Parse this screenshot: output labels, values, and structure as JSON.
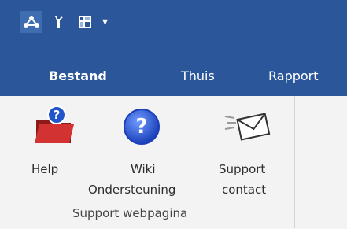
{
  "quick_access": {
    "icons": [
      "network-icon",
      "wrench-icon",
      "grid-icon",
      "dropdown-icon"
    ]
  },
  "tabs": [
    {
      "label": "Bestand"
    },
    {
      "label": "Thuis"
    },
    {
      "label": "Rapport"
    }
  ],
  "ribbon": {
    "buttons": [
      {
        "label": "Help",
        "icon": "help-folder-icon"
      },
      {
        "label_line1": "Wiki",
        "label_line2": "Ondersteuning",
        "icon": "question-circle-icon"
      },
      {
        "label_line1": "Support",
        "label_line2": "contact",
        "icon": "envelope-icon"
      }
    ],
    "group_label": "Support webpagina"
  },
  "colors": {
    "titlebar": "#2b579a",
    "accent_blue": "#2255cc",
    "folder_red": "#c62828"
  }
}
